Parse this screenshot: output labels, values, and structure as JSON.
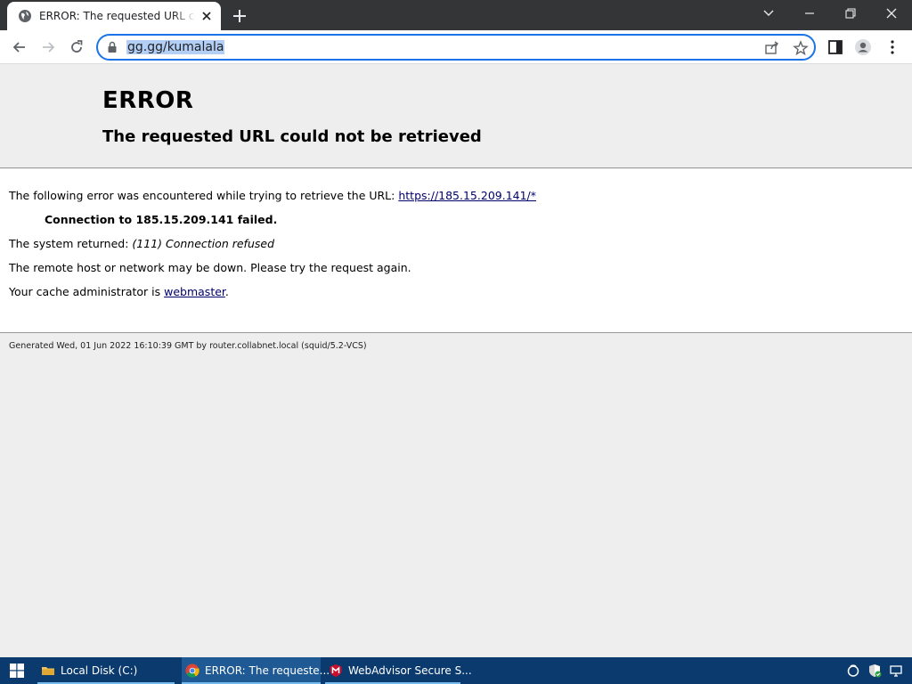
{
  "browser": {
    "tab_title": "ERROR: The requested URL could not be retrieved",
    "url": "gg.gg/kumalala"
  },
  "content": {
    "heading": "ERROR",
    "subheading": "The requested URL could not be retrieved",
    "line1_text": "The following error was encountered while trying to retrieve the URL: ",
    "line1_link": "https://185.15.209.141/*",
    "failed_text": "Connection to 185.15.209.141 failed.",
    "system_prefix": "The system returned: ",
    "system_detail": "(111) Connection refused",
    "remote_text": "The remote host or network may be down. Please try the request again.",
    "cache_prefix": "Your cache administrator is ",
    "cache_link": "webmaster",
    "cache_suffix": ".",
    "footer": "Generated Wed, 01 Jun 2022 16:10:39 GMT by router.collabnet.local (squid/5.2-VCS)"
  },
  "taskbar": {
    "items": [
      {
        "label": "Local Disk (C:)",
        "icon": "folder-icon"
      },
      {
        "label": "ERROR: The requeste...",
        "icon": "chrome-icon"
      },
      {
        "label": "WebAdvisor Secure S...",
        "icon": "mcafee-icon"
      }
    ]
  },
  "colors": {
    "titlebar": "#343536",
    "focus_ring": "#1a73e8",
    "taskbar": "#0b3b6e",
    "link": "#00006b"
  }
}
